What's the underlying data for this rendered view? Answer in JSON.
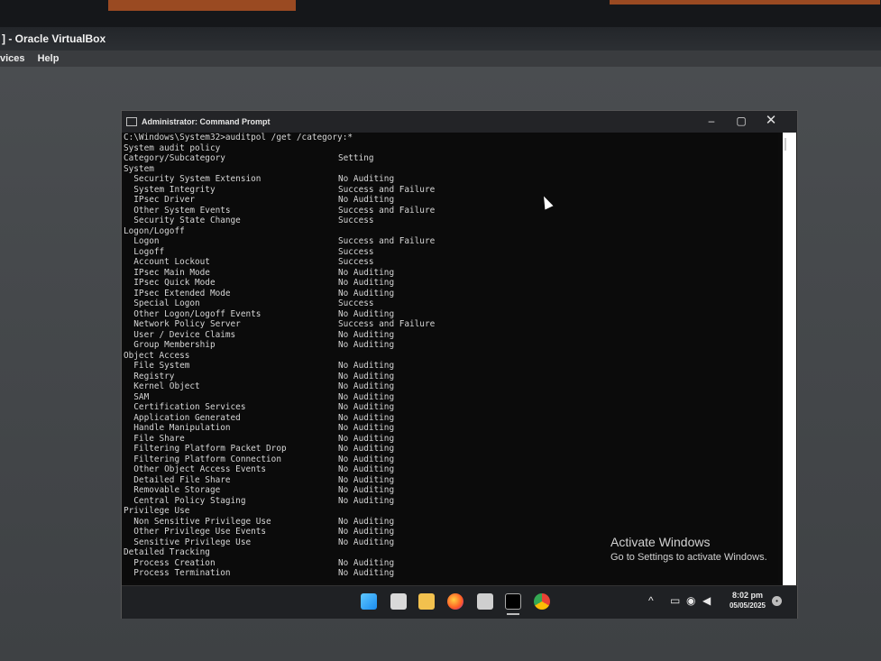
{
  "vbox": {
    "title": "] - Oracle VirtualBox",
    "menu": [
      "vices",
      "Help"
    ]
  },
  "cmd": {
    "title": "Administrator: Command Prompt",
    "controls": {
      "minimize": "–",
      "maximize": "▢",
      "close": "✕"
    },
    "lines": [
      {
        "c1": "C:\\Windows\\System32>auditpol /get /category:*",
        "c2": ""
      },
      {
        "c1": "System audit policy",
        "c2": ""
      },
      {
        "c1": "Category/Subcategory",
        "c2": "Setting"
      },
      {
        "c1": "System",
        "c2": ""
      },
      {
        "c1": "  Security System Extension",
        "c2": "No Auditing"
      },
      {
        "c1": "  System Integrity",
        "c2": "Success and Failure"
      },
      {
        "c1": "  IPsec Driver",
        "c2": "No Auditing"
      },
      {
        "c1": "  Other System Events",
        "c2": "Success and Failure"
      },
      {
        "c1": "  Security State Change",
        "c2": "Success"
      },
      {
        "c1": "Logon/Logoff",
        "c2": ""
      },
      {
        "c1": "  Logon",
        "c2": "Success and Failure"
      },
      {
        "c1": "  Logoff",
        "c2": "Success"
      },
      {
        "c1": "  Account Lockout",
        "c2": "Success"
      },
      {
        "c1": "  IPsec Main Mode",
        "c2": "No Auditing"
      },
      {
        "c1": "  IPsec Quick Mode",
        "c2": "No Auditing"
      },
      {
        "c1": "  IPsec Extended Mode",
        "c2": "No Auditing"
      },
      {
        "c1": "  Special Logon",
        "c2": "Success"
      },
      {
        "c1": "  Other Logon/Logoff Events",
        "c2": "No Auditing"
      },
      {
        "c1": "  Network Policy Server",
        "c2": "Success and Failure"
      },
      {
        "c1": "  User / Device Claims",
        "c2": "No Auditing"
      },
      {
        "c1": "  Group Membership",
        "c2": "No Auditing"
      },
      {
        "c1": "Object Access",
        "c2": ""
      },
      {
        "c1": "  File System",
        "c2": "No Auditing"
      },
      {
        "c1": "  Registry",
        "c2": "No Auditing"
      },
      {
        "c1": "  Kernel Object",
        "c2": "No Auditing"
      },
      {
        "c1": "  SAM",
        "c2": "No Auditing"
      },
      {
        "c1": "  Certification Services",
        "c2": "No Auditing"
      },
      {
        "c1": "  Application Generated",
        "c2": "No Auditing"
      },
      {
        "c1": "  Handle Manipulation",
        "c2": "No Auditing"
      },
      {
        "c1": "  File Share",
        "c2": "No Auditing"
      },
      {
        "c1": "  Filtering Platform Packet Drop",
        "c2": "No Auditing"
      },
      {
        "c1": "  Filtering Platform Connection",
        "c2": "No Auditing"
      },
      {
        "c1": "  Other Object Access Events",
        "c2": "No Auditing"
      },
      {
        "c1": "  Detailed File Share",
        "c2": "No Auditing"
      },
      {
        "c1": "  Removable Storage",
        "c2": "No Auditing"
      },
      {
        "c1": "  Central Policy Staging",
        "c2": "No Auditing"
      },
      {
        "c1": "Privilege Use",
        "c2": ""
      },
      {
        "c1": "  Non Sensitive Privilege Use",
        "c2": "No Auditing"
      },
      {
        "c1": "  Other Privilege Use Events",
        "c2": "No Auditing"
      },
      {
        "c1": "  Sensitive Privilege Use",
        "c2": "No Auditing"
      },
      {
        "c1": "Detailed Tracking",
        "c2": ""
      },
      {
        "c1": "  Process Creation",
        "c2": "No Auditing"
      },
      {
        "c1": "  Process Termination",
        "c2": "No Auditing"
      }
    ]
  },
  "watermark": {
    "title": "Activate Windows",
    "subtitle": "Go to Settings to activate Windows."
  },
  "taskbar": {
    "icons": [
      "windows-start-icon",
      "task-view-icon",
      "file-explorer-icon",
      "firefox-icon",
      "clapper-icon",
      "terminal-icon",
      "chrome-icon"
    ],
    "tray_chevron": "^",
    "time": "8:02 pm",
    "date": "05/05/2025"
  }
}
